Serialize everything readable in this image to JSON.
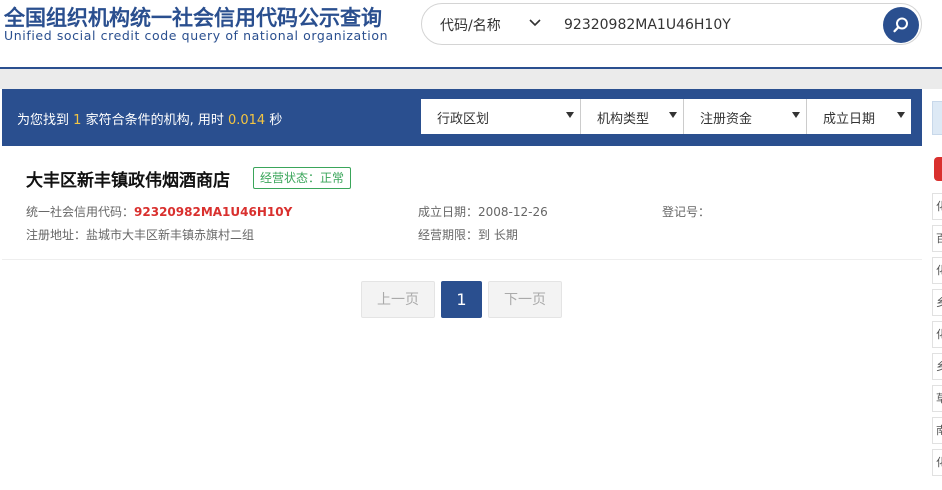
{
  "header": {
    "title": "全国组织机构统一社会信用代码公示查询",
    "subtitle": "Unified social credit code query of national organization"
  },
  "search": {
    "type_label": "代码/名称",
    "value": "92320982MA1U46H10Y"
  },
  "summary": {
    "prefix": "为您找到",
    "count": "1",
    "middle": "家符合条件的机构, 用时",
    "time": "0.014",
    "suffix": "秒"
  },
  "filters": [
    {
      "label": "行政区划"
    },
    {
      "label": "机构类型"
    },
    {
      "label": "注册资金"
    },
    {
      "label": "成立日期"
    }
  ],
  "result": {
    "name": "大丰区新丰镇政伟烟酒商店",
    "status": "经营状态：正常",
    "credit_code_label": "统一社会信用代码：",
    "credit_code": "92320982MA1U46H10Y",
    "address_label": "注册地址：",
    "address": "盐城市大丰区新丰镇赤旗村二组",
    "founded_label": "成立日期：",
    "founded": "2008-12-26",
    "term_label": "经营期限：",
    "term": "到 长期",
    "reg_no_label": "登记号："
  },
  "pagination": {
    "prev": "上一页",
    "current": "1",
    "next": "下一页"
  },
  "right_strip": {
    "items": [
      "化",
      "百",
      "化",
      "乡",
      "化",
      "乡",
      "草",
      "南",
      "化"
    ]
  },
  "colors": {
    "brand": "#2a4f8f",
    "highlight": "#f4c542",
    "code_red": "#d9302e",
    "status_green": "#3aa55a"
  }
}
